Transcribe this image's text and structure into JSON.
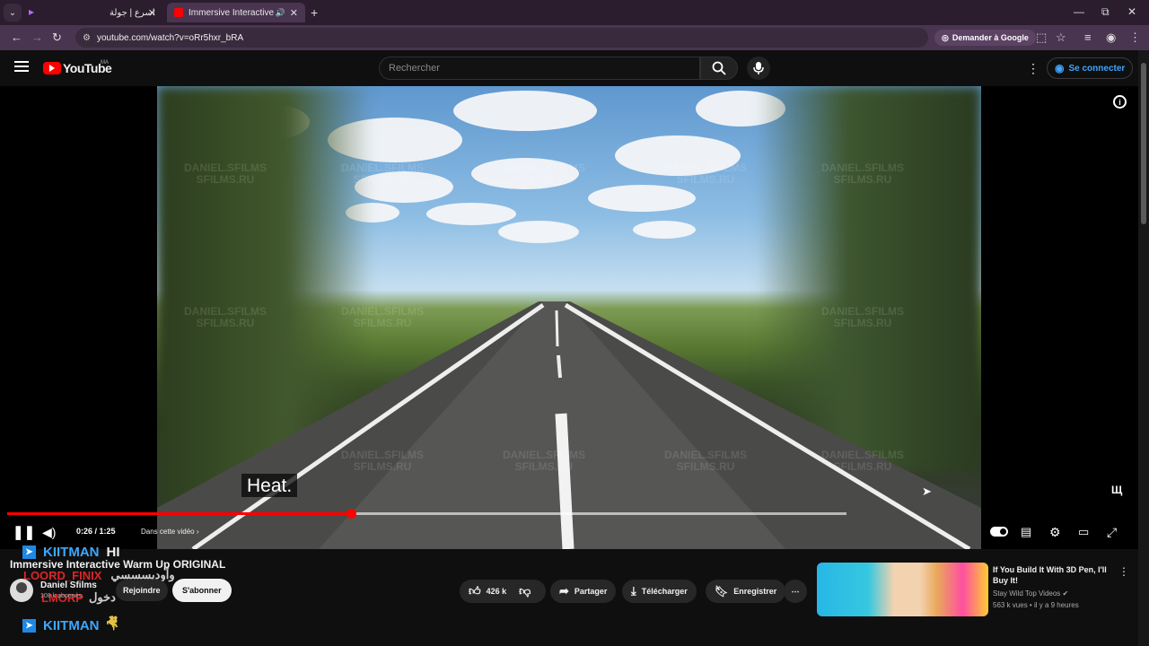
{
  "browser": {
    "tabs": [
      {
        "label": "اسرع | جولة",
        "active": false
      },
      {
        "label": "Immersive Interactive Warm",
        "active": true
      }
    ],
    "url": "youtube.com/watch?v=oRr5hxr_bRA",
    "ask_google": "Demander à Google"
  },
  "header": {
    "logo_text": "YouTube",
    "country_code": "MA",
    "search_placeholder": "Rechercher",
    "signin_label": "Se connecter"
  },
  "player": {
    "caption": "Heat.",
    "current_time": "0:26",
    "duration": "1:25",
    "time_display": "0:26 / 1:25",
    "chapter_label": "Dans cette vidéo",
    "played_fraction": 0.41,
    "buffered_fraction": 1.0,
    "watermark": "DANIEL.SFILMS\nSFILMS.RU",
    "brand_mark": "Щ"
  },
  "chat": [
    {
      "name": "KIITMAN",
      "message": "HI",
      "name_color": "#3ea6ff"
    },
    {
      "name": "LOORD_FINIX",
      "message": "وأوديسسسي",
      "name_color": "#ff2b2b"
    },
    {
      "name": "LMORP",
      "message": "دخول",
      "name_color": "#ff2b2b"
    },
    {
      "name": "KIITMAN",
      "message": "🤻",
      "name_color": "#3ea6ff"
    }
  ],
  "video": {
    "title": "Immersive Interactive Warm Up ORIGINAL",
    "channel": "Daniel Sfilms",
    "subscribers": "108 k abonnés",
    "join_label": "Rejoindre",
    "subscribe_label": "S'abonner",
    "likes": "426 k",
    "share_label": "Partager",
    "download_label": "Télécharger",
    "save_label": "Enregistrer"
  },
  "recommendation": {
    "title": "If You Build It With 3D Pen, I'll Buy It!",
    "channel": "Stay Wild Top Videos",
    "meta": "563 k vues • il y a 9 heures"
  },
  "colors": {
    "accent": "#ff0000",
    "link": "#3ea6ff",
    "background": "#0f0f0f"
  }
}
